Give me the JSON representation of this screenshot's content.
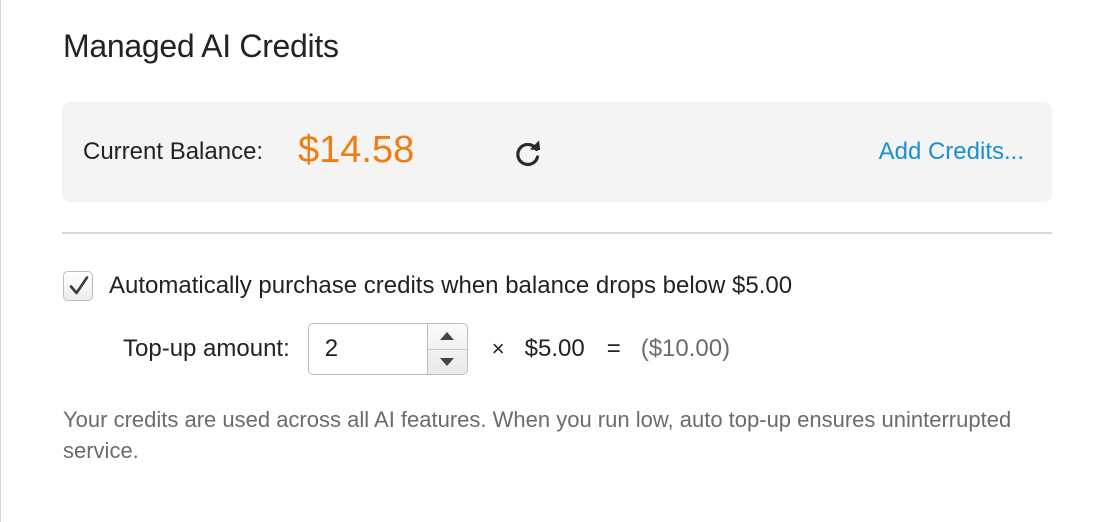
{
  "title": "Managed AI Credits",
  "balance": {
    "label": "Current Balance:",
    "amount": "$14.58",
    "amount_color": "#f07c12",
    "refresh_icon": "refresh-icon",
    "add_credits_label": "Add Credits...",
    "link_color": "#1a8fd1"
  },
  "auto_topup": {
    "checked": true,
    "label": "Automatically purchase credits when balance drops below $5.00",
    "amount_label": "Top-up amount:",
    "quantity": "2",
    "multiply_symbol": "×",
    "unit_price": "$5.00",
    "equals_symbol": "=",
    "total": "($10.00)"
  },
  "help_text": "Your credits are used across all AI features. When you run low, auto top-up ensures uninterrupted service."
}
